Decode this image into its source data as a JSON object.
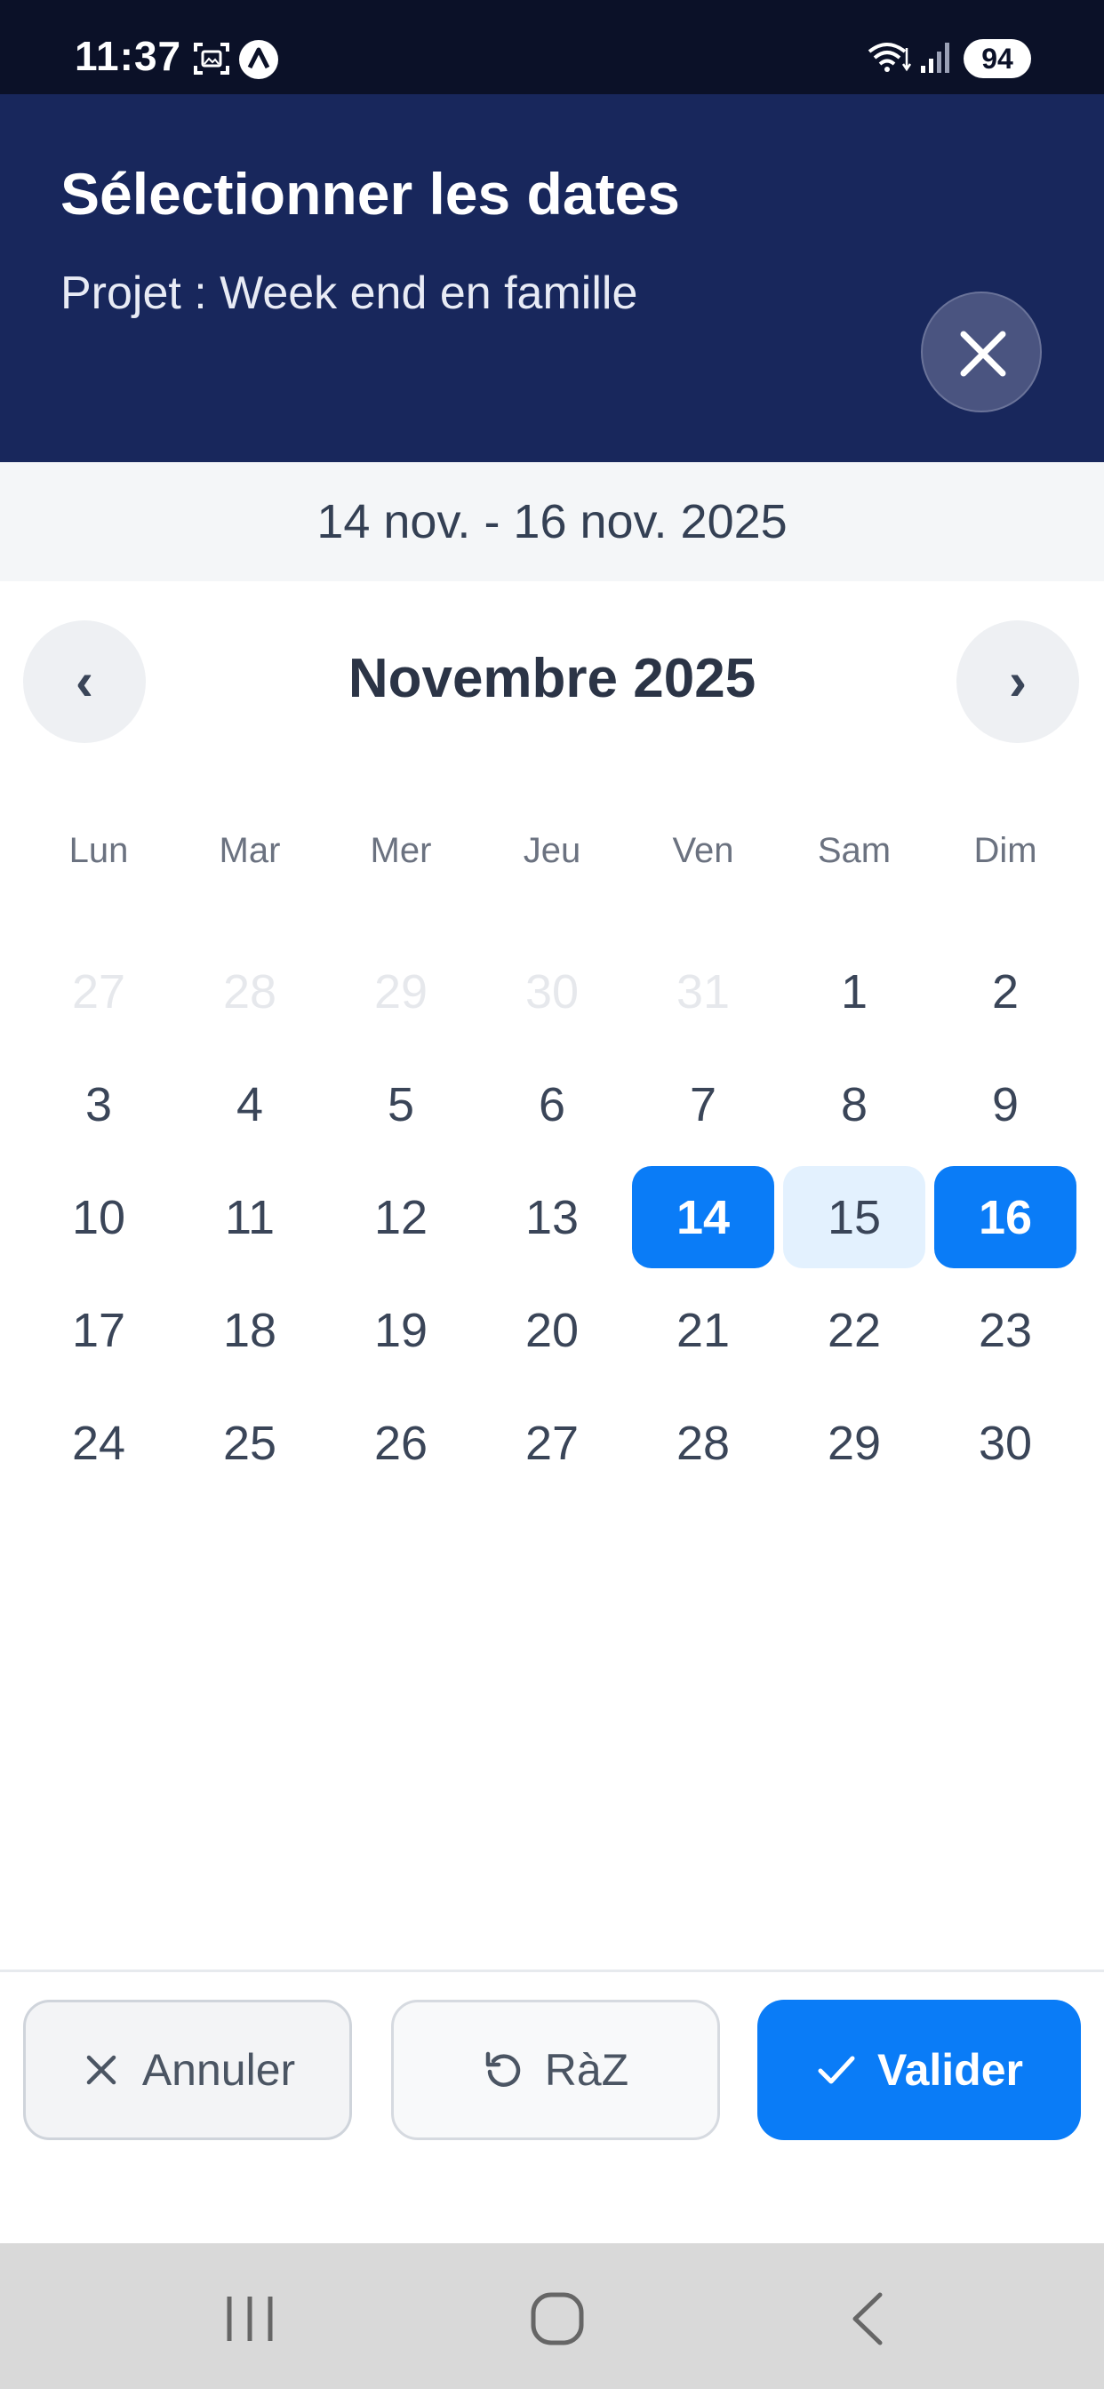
{
  "status_bar": {
    "time": "11:37",
    "battery": "94"
  },
  "header": {
    "title": "Sélectionner les dates",
    "subtitle": "Projet : Week end en famille",
    "close_icon": "close-icon"
  },
  "range_text": "14 nov. - 16 nov. 2025",
  "calendar": {
    "month_label": "Novembre 2025",
    "prev_label": "‹",
    "next_label": "›",
    "weekdays": [
      "Lun",
      "Mar",
      "Mer",
      "Jeu",
      "Ven",
      "Sam",
      "Dim"
    ],
    "days": [
      {
        "label": "27",
        "state": "muted"
      },
      {
        "label": "28",
        "state": "muted"
      },
      {
        "label": "29",
        "state": "muted"
      },
      {
        "label": "30",
        "state": "muted"
      },
      {
        "label": "31",
        "state": "muted"
      },
      {
        "label": "1",
        "state": "normal"
      },
      {
        "label": "2",
        "state": "normal"
      },
      {
        "label": "3",
        "state": "normal"
      },
      {
        "label": "4",
        "state": "normal"
      },
      {
        "label": "5",
        "state": "normal"
      },
      {
        "label": "6",
        "state": "normal"
      },
      {
        "label": "7",
        "state": "normal"
      },
      {
        "label": "8",
        "state": "normal"
      },
      {
        "label": "9",
        "state": "normal"
      },
      {
        "label": "10",
        "state": "normal"
      },
      {
        "label": "11",
        "state": "normal"
      },
      {
        "label": "12",
        "state": "normal"
      },
      {
        "label": "13",
        "state": "normal"
      },
      {
        "label": "14",
        "state": "selected"
      },
      {
        "label": "15",
        "state": "inrange"
      },
      {
        "label": "16",
        "state": "selected"
      },
      {
        "label": "17",
        "state": "normal"
      },
      {
        "label": "18",
        "state": "normal"
      },
      {
        "label": "19",
        "state": "normal"
      },
      {
        "label": "20",
        "state": "normal"
      },
      {
        "label": "21",
        "state": "normal"
      },
      {
        "label": "22",
        "state": "normal"
      },
      {
        "label": "23",
        "state": "normal"
      },
      {
        "label": "24",
        "state": "normal"
      },
      {
        "label": "25",
        "state": "normal"
      },
      {
        "label": "26",
        "state": "normal"
      },
      {
        "label": "27",
        "state": "normal"
      },
      {
        "label": "28",
        "state": "normal"
      },
      {
        "label": "29",
        "state": "normal"
      },
      {
        "label": "30",
        "state": "normal"
      }
    ]
  },
  "footer": {
    "cancel_label": "Annuler",
    "reset_label": "RàZ",
    "validate_label": "Valider"
  },
  "colors": {
    "header_bg": "#18275c",
    "accent": "#0a7cf7",
    "range_bg": "#e3f1fe"
  }
}
